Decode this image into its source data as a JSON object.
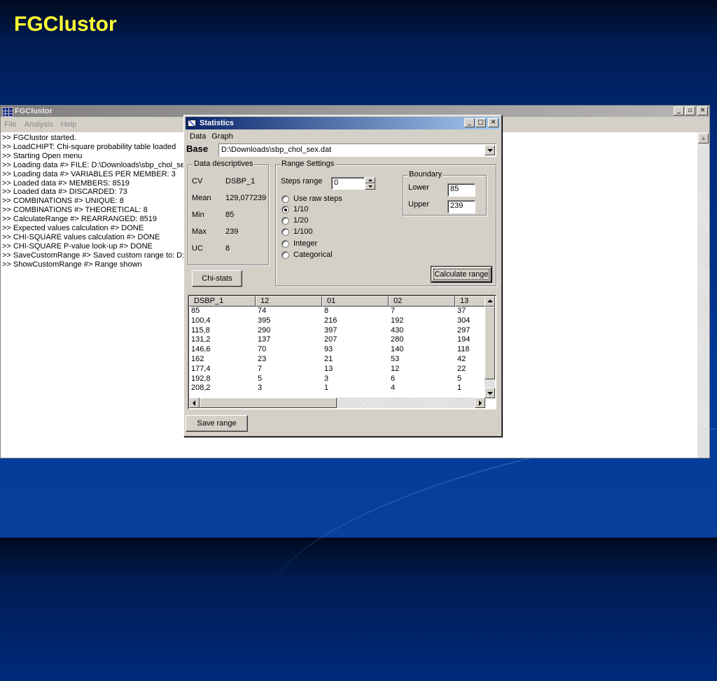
{
  "slide_title": "FGClustor",
  "main_window": {
    "title": "FGClustor",
    "menu": [
      "File",
      "Analysis",
      "Help"
    ],
    "log_lines": [
      ">> FGClustor started.",
      ">> LoadCHIPT: Chi-square probability table loaded",
      ">> Starting Open menu",
      ">> Loading data #> FILE: D:\\Downloads\\sbp_chol_sex",
      ">> Loading data #> VARIABLES PER MEMBER: 3",
      ">> Loaded data #> MEMBERS: 8519",
      ">> Loaded data #> DISCARDED: 73",
      ">> COMBINATIONS #> UNIQUE: 8",
      ">> COMBINATIONS #> THEORETICAL: 8",
      ">> CalculateRange #> REARRANGED: 8519",
      ">> Expected values calculation #> DONE",
      ">> CHI-SQUARE values calculation #> DONE",
      ">> CHI-SQUARE P-value look-up #> DONE",
      ">> SaveCustomRange #> Saved custom range to: D:\\D",
      ">> ShowCustomRange #> Range shown"
    ]
  },
  "stats_dialog": {
    "title": "Statistics",
    "menu": [
      "Data",
      "Graph"
    ],
    "base_label": "Base",
    "base_value": "D:\\Downloads\\sbp_chol_sex.dat",
    "descriptives": {
      "legend": "Data descriptives",
      "rows": [
        {
          "label": "CV",
          "value": "DSBP_1"
        },
        {
          "label": "Mean",
          "value": "129,077239"
        },
        {
          "label": "Min",
          "value": "85"
        },
        {
          "label": "Max",
          "value": "239"
        },
        {
          "label": "UC",
          "value": "8"
        }
      ]
    },
    "chi_stats_label": "Chi-stats",
    "range_settings": {
      "legend": "Range Settings",
      "steps_label": "Steps range",
      "steps_value": "0",
      "options": [
        {
          "label": "Use raw steps",
          "checked": false
        },
        {
          "label": "1/10",
          "checked": true
        },
        {
          "label": "1/20",
          "checked": false
        },
        {
          "label": "1/100",
          "checked": false
        },
        {
          "label": "Integer",
          "checked": false
        },
        {
          "label": "Categorical",
          "checked": false
        }
      ],
      "boundary": {
        "legend": "Boundary",
        "lower_label": "Lower",
        "lower_value": "85",
        "upper_label": "Upper",
        "upper_value": "239"
      },
      "calculate_label": "Calculate range"
    },
    "grid": {
      "columns": [
        "DSBP_1",
        "12",
        "01",
        "02",
        "13"
      ],
      "rows": [
        [
          "85",
          "74",
          "8",
          "7",
          "37"
        ],
        [
          "100,4",
          "395",
          "216",
          "192",
          "304"
        ],
        [
          "115,8",
          "290",
          "397",
          "430",
          "297"
        ],
        [
          "131,2",
          "137",
          "207",
          "280",
          "194"
        ],
        [
          "146,6",
          "70",
          "93",
          "140",
          "118"
        ],
        [
          "162",
          "23",
          "21",
          "53",
          "42"
        ],
        [
          "177,4",
          "7",
          "13",
          "12",
          "22"
        ],
        [
          "192,8",
          "5",
          "3",
          "6",
          "5"
        ],
        [
          "208,2",
          "3",
          "1",
          "4",
          "1"
        ]
      ]
    },
    "save_range_label": "Save range"
  }
}
